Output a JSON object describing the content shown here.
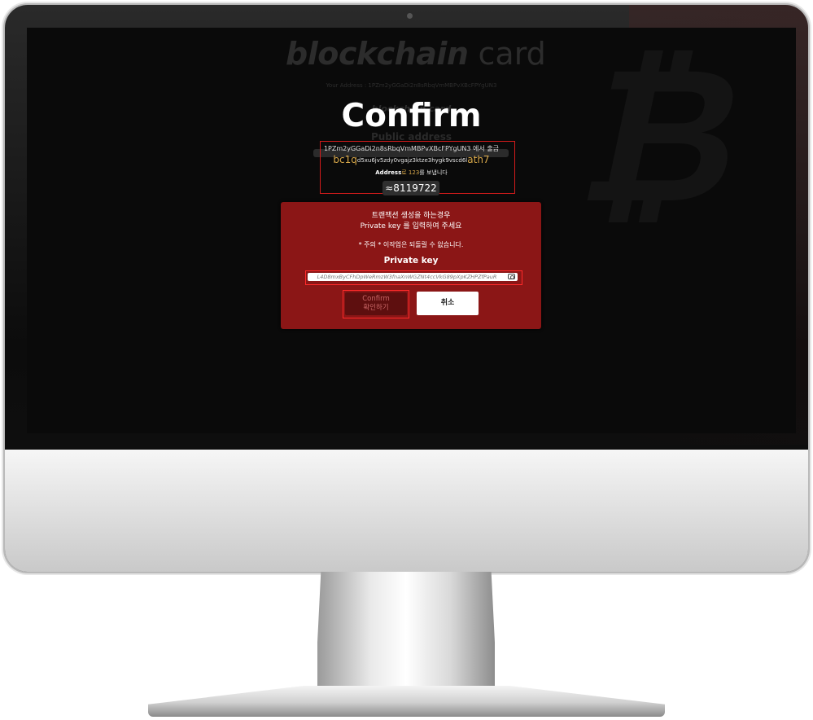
{
  "background_site": {
    "logo_bold": "blockchain",
    "logo_light": "card",
    "address_line": "Your Address : 1PZm2yGGaDi2n8sRbqVmMBPvXBcFPYgUN3",
    "subtitle": "blockchain card",
    "public_address_label": "Public address"
  },
  "confirm": {
    "title": "Confirm",
    "from_line": "1PZm2yGGaDi2n8sRbqVmMBPvXBcFPYgUN3 에서 출금",
    "to_prefix": "bc1q",
    "to_middle": "d5xu6jv5zdy0vgajz3ktze3hygk9vscd6l",
    "to_suffix": "ath7",
    "send_bold": "Address",
    "send_amount": "로 123",
    "send_tail": "를 보냅니다",
    "amount": "≈8119722"
  },
  "modal": {
    "line1": "트랜잭션 생성을 하는경우",
    "line2": "Private key 를 입력하여 주세요",
    "warning": "* 주의 * 이작업은 되돌릴 수 없습니다.",
    "private_key_label": "Private key",
    "private_key_value": "L4D8mxByCFhDpWeRmzW3fnaXnWGZNt4ccVkG89pXpKZHPZfPauR",
    "confirm_line1": "Confirm",
    "confirm_line2": "확인하기",
    "cancel_label": "취소"
  },
  "icons": {
    "camera": "camera-icon",
    "bitcoin_watermark": "bitcoin-logo"
  }
}
